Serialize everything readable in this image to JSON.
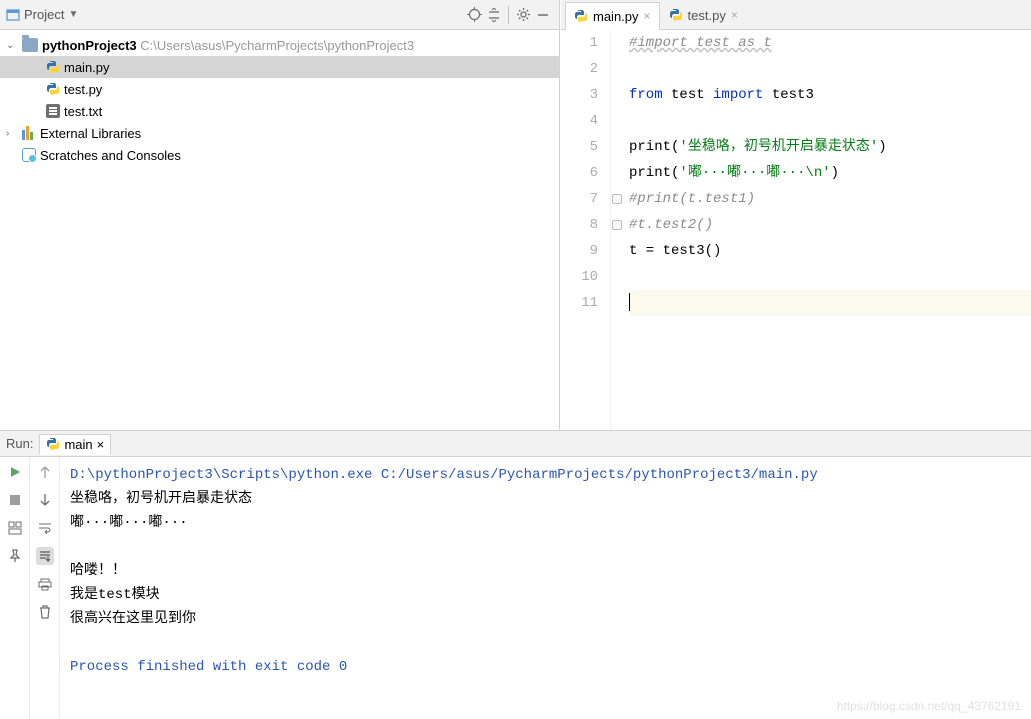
{
  "project": {
    "header_label": "Project",
    "root_name": "pythonProject3",
    "root_path": "C:\\Users\\asus\\PycharmProjects\\pythonProject3",
    "files": [
      {
        "name": "main.py",
        "type": "py",
        "selected": true
      },
      {
        "name": "test.py",
        "type": "py",
        "selected": false
      },
      {
        "name": "test.txt",
        "type": "txt",
        "selected": false
      }
    ],
    "external_libs": "External Libraries",
    "scratches": "Scratches and Consoles"
  },
  "tabs": [
    {
      "label": "main.py",
      "active": true
    },
    {
      "label": "test.py",
      "active": false
    }
  ],
  "code": {
    "lines": [
      {
        "n": 1,
        "segs": [
          {
            "t": "#import test as t",
            "c": "cmt cmt-u"
          }
        ]
      },
      {
        "n": 2,
        "segs": []
      },
      {
        "n": 3,
        "segs": [
          {
            "t": "from ",
            "c": "kw"
          },
          {
            "t": "test "
          },
          {
            "t": "import ",
            "c": "kw"
          },
          {
            "t": "test3"
          }
        ]
      },
      {
        "n": 4,
        "segs": []
      },
      {
        "n": 5,
        "segs": [
          {
            "t": "print("
          },
          {
            "t": "'坐稳咯，初号机开启暴走状态'",
            "c": "str"
          },
          {
            "t": ")"
          }
        ]
      },
      {
        "n": 6,
        "segs": [
          {
            "t": "print("
          },
          {
            "t": "'嘟···嘟···嘟···\\n'",
            "c": "str"
          },
          {
            "t": ")"
          }
        ]
      },
      {
        "n": 7,
        "segs": [
          {
            "t": "#print(t.test1)",
            "c": "cmt"
          }
        ],
        "mark": true
      },
      {
        "n": 8,
        "segs": [
          {
            "t": "#t.test2()",
            "c": "cmt"
          }
        ],
        "mark": true
      },
      {
        "n": 9,
        "segs": [
          {
            "t": "t = test3()"
          }
        ]
      },
      {
        "n": 10,
        "segs": []
      },
      {
        "n": 11,
        "segs": [],
        "cursor": true,
        "hl": true
      }
    ]
  },
  "run": {
    "label": "Run:",
    "tab_name": "main",
    "output": [
      {
        "t": "D:\\pythonProject3\\Scripts\\python.exe C:/Users/asus/PycharmProjects/pythonProject3/main.py",
        "c": "cmd"
      },
      {
        "t": "坐稳咯，初号机开启暴走状态"
      },
      {
        "t": "嘟···嘟···嘟···"
      },
      {
        "t": ""
      },
      {
        "t": "哈喽！！"
      },
      {
        "t": "我是test模块"
      },
      {
        "t": "很高兴在这里见到你"
      },
      {
        "t": ""
      },
      {
        "t": "Process finished with exit code 0",
        "c": "cmd"
      }
    ]
  },
  "watermark": "https://blog.csdn.net/qq_43762191"
}
